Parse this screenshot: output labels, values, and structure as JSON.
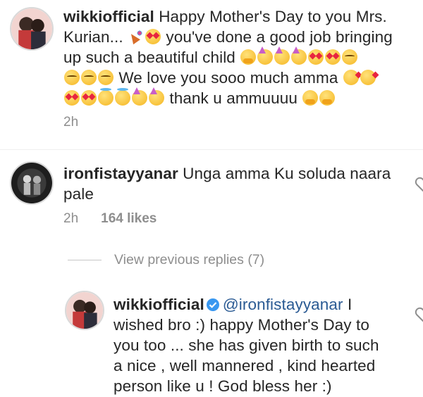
{
  "comments": [
    {
      "username": "wikkiofficial",
      "line1": "Happy Mother's Day to you Mrs.",
      "line2_text": "Kurian...",
      "line2_after": "you've done a good job bringing",
      "line3": "up such a beautiful child",
      "line4": "We love you sooo much amma",
      "line5": "thank u ammuuuu",
      "time": "2h"
    },
    {
      "username": "ironfistayyanar",
      "line1": "Unga amma Ku soluda naara",
      "line2": "pale",
      "time": "2h",
      "likes": "164 likes"
    }
  ],
  "view_previous": "View previous replies (7)",
  "reply": {
    "username": "wikkiofficial",
    "mention": "@ironfistayyanar",
    "line1_end": "I",
    "line2": "wished bro :) happy Mother's Day to",
    "line3": "you too ... she has given birth to such",
    "line4": "a nice , well mannered , kind hearted",
    "line5": "person like u ! God bless her :)"
  },
  "colors": {
    "text": "#262626",
    "meta": "#8e8e8e",
    "mention": "#2a5a93",
    "verified": "#3897f0"
  }
}
